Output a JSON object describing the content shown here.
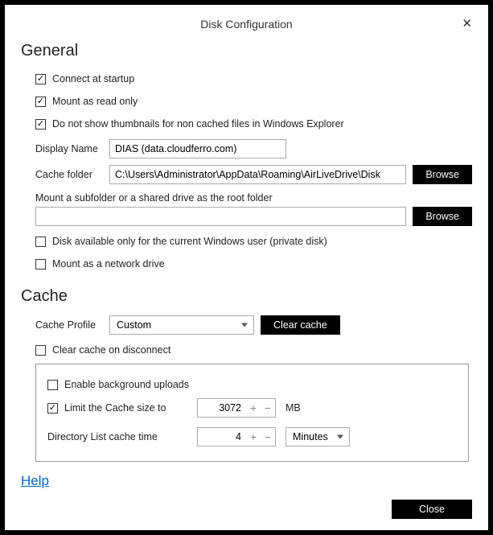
{
  "title": "Disk Configuration",
  "general": {
    "heading": "General",
    "connect_startup": {
      "label": "Connect at startup",
      "checked": true
    },
    "mount_readonly": {
      "label": "Mount as read only",
      "checked": true
    },
    "no_thumbnails": {
      "label": "Do not show thumbnails for non cached files in Windows Explorer",
      "checked": true
    },
    "display_name_label": "Display Name",
    "display_name_value": "DIAS (data.cloudferro.com)",
    "cache_folder_label": "Cache folder",
    "cache_folder_value": "C:\\Users\\Administrator\\AppData\\Roaming\\AirLiveDrive\\Disk",
    "browse": "Browse",
    "subfolder_label": "Mount a subfolder or a shared drive as the root folder",
    "subfolder_value": "",
    "private_disk": {
      "label": "Disk available only for the current Windows user (private disk)",
      "checked": false
    },
    "network_drive": {
      "label": "Mount as a network drive",
      "checked": false
    }
  },
  "cache": {
    "heading": "Cache",
    "profile_label": "Cache Profile",
    "profile_value": "Custom",
    "clear_cache": "Clear cache",
    "clear_on_disconnect": {
      "label": "Clear cache on disconnect",
      "checked": false
    },
    "enable_bg_uploads": {
      "label": "Enable background uploads",
      "checked": false
    },
    "limit_cache": {
      "label": "Limit the Cache size to",
      "checked": true
    },
    "limit_value": "3072",
    "limit_unit": "MB",
    "dir_list_label": "Directory List cache time",
    "dir_list_value": "4",
    "dir_list_unit": "Minutes"
  },
  "help": "Help",
  "close": "Close"
}
